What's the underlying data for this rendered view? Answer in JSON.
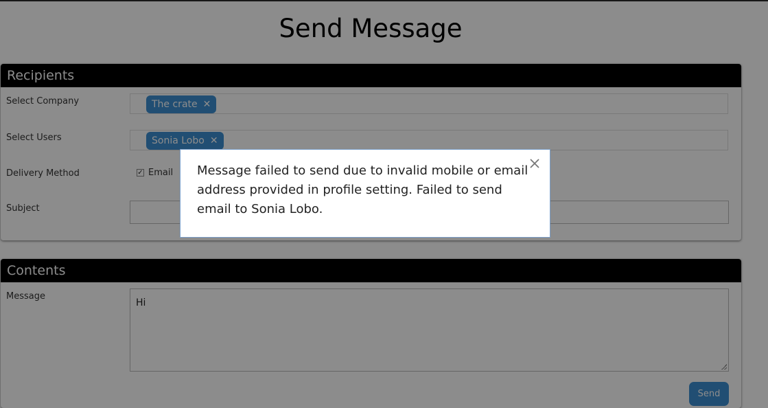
{
  "page": {
    "title": "Send Message"
  },
  "recipients": {
    "header": "Recipients",
    "company_label": "Select Company",
    "company_tags": [
      "The crate"
    ],
    "users_label": "Select Users",
    "user_tags": [
      "Sonia Lobo"
    ],
    "delivery_label": "Delivery Method",
    "delivery_options": [
      {
        "label": "Email",
        "checked": true
      }
    ],
    "subject_label": "Subject",
    "subject_value": ""
  },
  "contents": {
    "header": "Contents",
    "message_label": "Message",
    "message_value": "Hi",
    "send_label": "Send"
  },
  "modal": {
    "message": "Message failed to send due to invalid mobile or email address provided in profile setting. Failed to send email to Sonia Lobo."
  },
  "colors": {
    "accent": "#3d8fd1",
    "header_bg": "#000000"
  },
  "icons": {
    "tag_remove": "x-icon",
    "modal_close": "close-icon",
    "checkbox": "check-icon"
  }
}
